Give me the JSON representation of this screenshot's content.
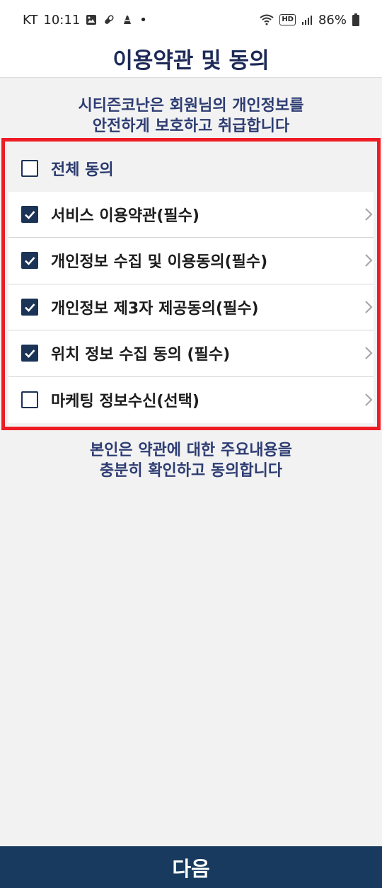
{
  "status_bar": {
    "carrier": "KT",
    "time": "10:11",
    "dot": "•",
    "hd": "HD",
    "battery": "86%"
  },
  "header": {
    "title": "이용약관 및 동의"
  },
  "intro": {
    "line1": "시티즌코난은 회원님의 개인정보를",
    "line2": "안전하게 보호하고 취급합니다"
  },
  "terms": {
    "all": {
      "label": "전체 동의",
      "checked": false
    },
    "items": [
      {
        "label": "서비스 이용약관(필수)",
        "checked": true
      },
      {
        "label": "개인정보 수집 및 이용동의(필수)",
        "checked": true
      },
      {
        "label": "개인정보 제3자 제공동의(필수)",
        "checked": true
      },
      {
        "label": "위치 정보 수집 동의 (필수)",
        "checked": true
      },
      {
        "label": "마케팅 정보수신(선택)",
        "checked": false
      }
    ]
  },
  "outro": {
    "line1": "본인은 약관에 대한 주요내용을",
    "line2": "충분히 확인하고 동의합니다"
  },
  "footer": {
    "next_label": "다음"
  },
  "colors": {
    "navy": "#1b3356",
    "title": "#1d2a57",
    "highlight_border": "#ee1c25",
    "button_bg": "#173a5e"
  }
}
